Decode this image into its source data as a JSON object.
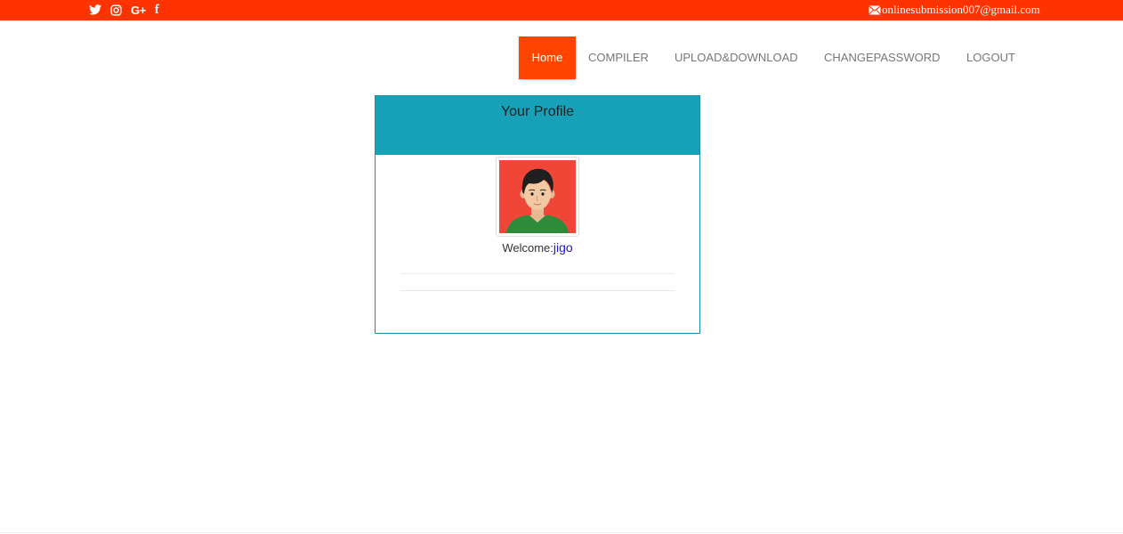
{
  "topbar": {
    "bg_color": "#ff3300",
    "social_icons": [
      "twitter-icon",
      "instagram-icon",
      "google-plus-icon",
      "facebook-icon"
    ],
    "google_plus_glyph": "G+",
    "facebook_glyph": "f",
    "email": "onlinesubmission007@gmail.com"
  },
  "nav": {
    "home": "Home",
    "compiler": "COMPILER",
    "upload_download": "UPLOAD&DOWNLOAD",
    "change_password": "CHANGEPASSWORD",
    "logout": "LOGOUT",
    "active": "Home",
    "active_color": "#ff4500"
  },
  "profile": {
    "title": "Your Profile",
    "header_color": "#17a1b8",
    "welcome_label": "Welcome:",
    "username": "jigo"
  }
}
